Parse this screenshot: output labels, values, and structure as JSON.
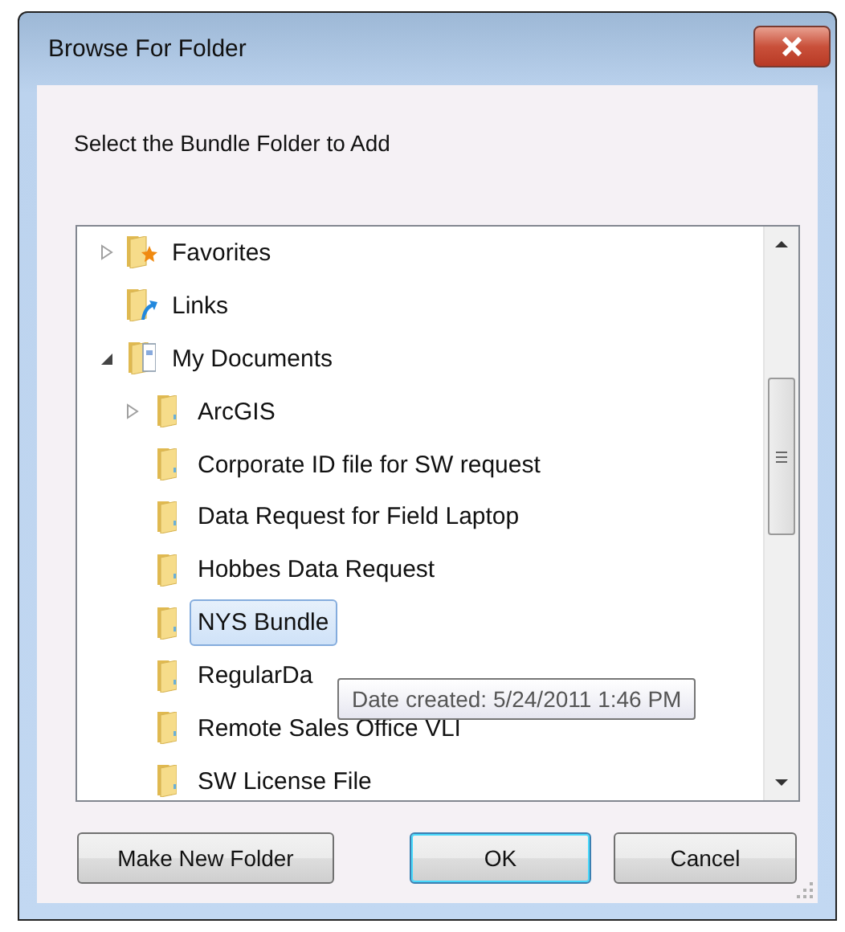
{
  "window": {
    "title": "Browse For Folder"
  },
  "prompt": "Select the Bundle Folder to Add",
  "tree": [
    {
      "label": "Favorites",
      "kind": "favorites",
      "expanded": false,
      "selected": false
    },
    {
      "label": "Links",
      "kind": "links",
      "selected": false
    },
    {
      "label": "My Documents",
      "kind": "documents",
      "expanded": true,
      "selected": false,
      "children": [
        {
          "label": "ArcGIS",
          "kind": "folder",
          "expanded": false,
          "selected": false
        },
        {
          "label": "Corporate ID file for SW request",
          "kind": "folder",
          "selected": false
        },
        {
          "label": "Data Request for Field Laptop",
          "kind": "folder",
          "selected": false
        },
        {
          "label": "Hobbes Data Request",
          "kind": "folder",
          "selected": false
        },
        {
          "label": "NYS Bundle",
          "kind": "folder",
          "selected": true
        },
        {
          "label": "RegularDa",
          "kind": "folder",
          "selected": false
        },
        {
          "label": "Remote Sales Office VLI",
          "kind": "folder",
          "selected": false
        },
        {
          "label": "SW License File",
          "kind": "folder",
          "selected": false
        }
      ]
    }
  ],
  "tooltip": "Date created: 5/24/2011 1:46 PM",
  "buttons": [
    {
      "label": "Make New Folder",
      "default": false
    },
    {
      "label": "OK",
      "default": true
    },
    {
      "label": "Cancel",
      "default": false
    }
  ]
}
